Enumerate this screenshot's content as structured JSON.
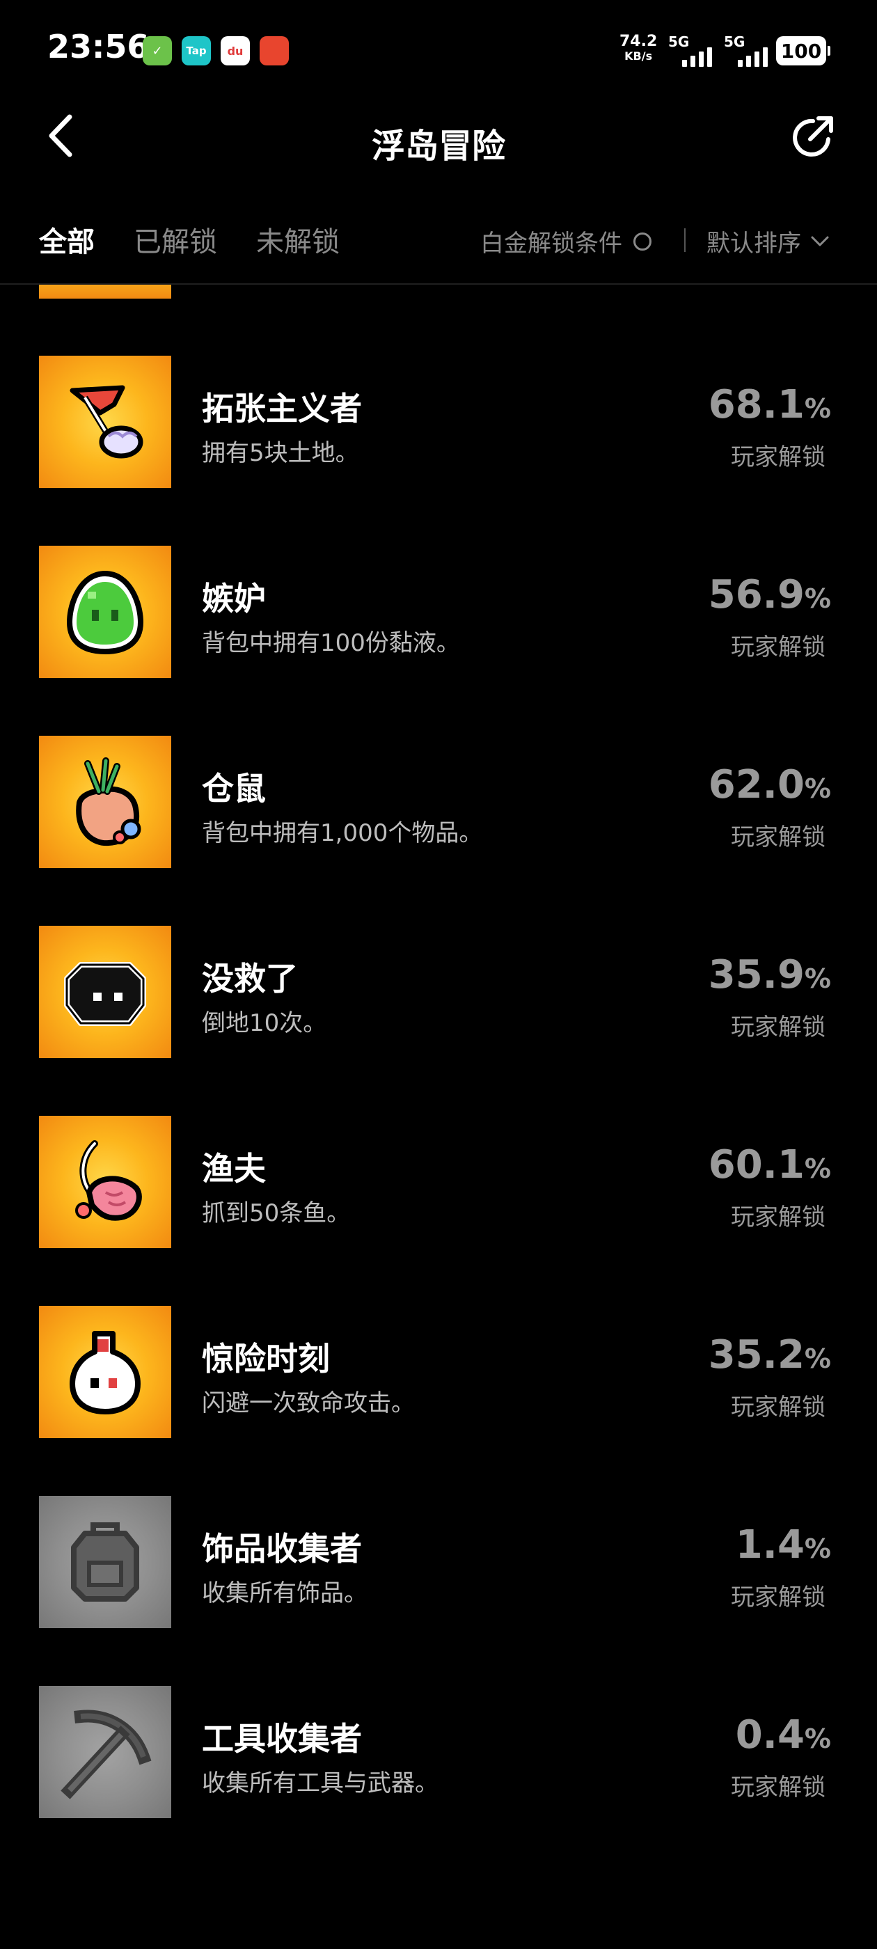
{
  "status_bar": {
    "time": "23:56",
    "app_icons": [
      {
        "name": "clipboard-app-icon",
        "label": "✓",
        "color": "#6cc24a"
      },
      {
        "name": "taptap-app-icon",
        "label": "Tap",
        "color": "#1ec5c8"
      },
      {
        "name": "map-app-icon",
        "label": "du",
        "color": "#ffffff"
      },
      {
        "name": "tomato-app-icon",
        "label": "",
        "color": "#e8452e"
      }
    ],
    "speed_value": "74.2",
    "speed_unit": "KB/s",
    "signal1_label": "5G",
    "signal2_label": "5G",
    "battery": "100"
  },
  "header": {
    "title": "浮岛冒险"
  },
  "tabs": [
    {
      "label": "全部",
      "active": true
    },
    {
      "label": "已解锁",
      "active": false
    },
    {
      "label": "未解锁",
      "active": false
    }
  ],
  "filter": {
    "label": "白金解锁条件"
  },
  "sort": {
    "label": "默认排序"
  },
  "achievements": [
    {
      "name": "拓张主义者",
      "desc": "拥有5块土地。",
      "percent": "68.1",
      "unit": "%",
      "sub": "玩家解锁",
      "unlocked": true,
      "icon": "flag-icon"
    },
    {
      "name": "嫉妒",
      "desc": "背包中拥有100份黏液。",
      "percent": "56.9",
      "unit": "%",
      "sub": "玩家解锁",
      "unlocked": true,
      "icon": "slime-icon"
    },
    {
      "name": "仓鼠",
      "desc": "背包中拥有1,000个物品。",
      "percent": "62.0",
      "unit": "%",
      "sub": "玩家解锁",
      "unlocked": true,
      "icon": "sack-icon"
    },
    {
      "name": "没救了",
      "desc": "倒地10次。",
      "percent": "35.9",
      "unit": "%",
      "sub": "玩家解锁",
      "unlocked": true,
      "icon": "black-blob-icon"
    },
    {
      "name": "渔夫",
      "desc": "抓到50条鱼。",
      "percent": "60.1",
      "unit": "%",
      "sub": "玩家解锁",
      "unlocked": true,
      "icon": "shrimp-icon"
    },
    {
      "name": "惊险时刻",
      "desc": "闪避一次致命攻击。",
      "percent": "35.2",
      "unit": "%",
      "sub": "玩家解锁",
      "unlocked": true,
      "icon": "potion-icon"
    },
    {
      "name": "饰品收集者",
      "desc": "收集所有饰品。",
      "percent": "1.4",
      "unit": "%",
      "sub": "玩家解锁",
      "unlocked": false,
      "icon": "backpack-icon"
    },
    {
      "name": "工具收集者",
      "desc": "收集所有工具与武器。",
      "percent": "0.4",
      "unit": "%",
      "sub": "玩家解锁",
      "unlocked": false,
      "icon": "pickaxe-icon"
    }
  ]
}
